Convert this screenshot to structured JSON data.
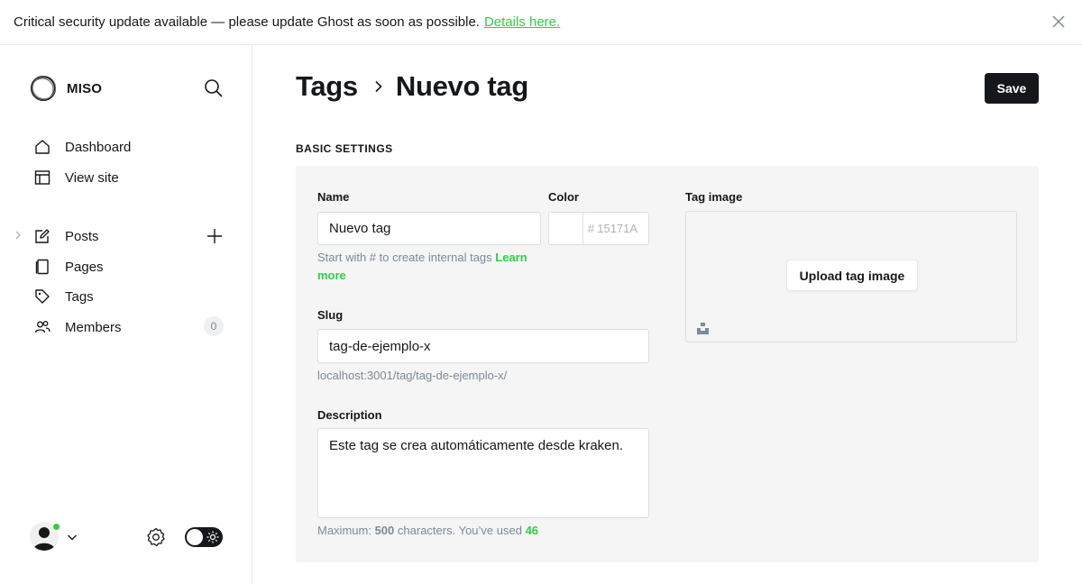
{
  "banner": {
    "message": "Critical security update available — please update Ghost as soon as possible.",
    "link": "Details here."
  },
  "sidebar": {
    "brand": "MISO",
    "items": [
      {
        "label": "Dashboard",
        "icon": "home-icon"
      },
      {
        "label": "View site",
        "icon": "layout-icon"
      },
      {
        "label": "Posts",
        "icon": "edit-icon"
      },
      {
        "label": "Pages",
        "icon": "page-icon"
      },
      {
        "label": "Tags",
        "icon": "tag-icon"
      },
      {
        "label": "Members",
        "icon": "users-icon",
        "count": "0"
      }
    ]
  },
  "header": {
    "breadcrumb_parent": "Tags",
    "title": "Nuevo tag",
    "save": "Save"
  },
  "form": {
    "section": "BASIC SETTINGS",
    "name_label": "Name",
    "name_value": "Nuevo tag",
    "name_hint": "Start with # to create internal tags",
    "name_hint_link": "Learn more",
    "color_label": "Color",
    "color_hash": "#",
    "color_placeholder": "15171A",
    "slug_label": "Slug",
    "slug_value": "tag-de-ejemplo-x",
    "slug_url": "localhost:3001/tag/tag-de-ejemplo-x/",
    "description_label": "Description",
    "description_value": "Este tag se crea automáticamente desde kraken.",
    "desc_hint_prefix": "Maximum:",
    "desc_max": "500",
    "desc_hint_mid": "characters. You’ve used",
    "desc_used": "46",
    "image_label": "Tag image",
    "upload_label": "Upload tag image"
  },
  "colors": {
    "accent": "#30cf43",
    "dark": "#15171a"
  }
}
